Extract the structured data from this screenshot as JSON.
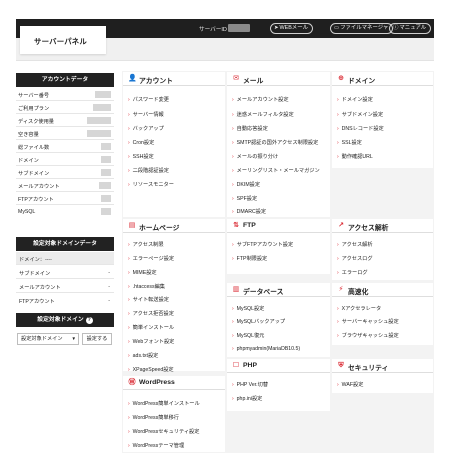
{
  "header": {
    "logo": "サーバーパネル",
    "server_id_label": "サーバーID",
    "buttons": [
      {
        "label": "WEBメール",
        "icon": "send-icon"
      },
      {
        "label": "ファイルマネージャ",
        "icon": "folder-icon"
      },
      {
        "label": "マニュアル",
        "icon": "info-icon"
      }
    ]
  },
  "account": {
    "title": "アカウントデータ",
    "rows": [
      {
        "label": "サーバー番号"
      },
      {
        "label": "ご利用プラン"
      },
      {
        "label": "ディスク使用量"
      },
      {
        "label": "空き容量"
      },
      {
        "label": "総ファイル数"
      },
      {
        "label": "ドメイン"
      },
      {
        "label": "サブドメイン"
      },
      {
        "label": "メールアカウント"
      },
      {
        "label": "FTPアカウント"
      },
      {
        "label": "MySQL"
      }
    ]
  },
  "domain_data": {
    "title": "設定対象ドメインデータ",
    "rows": [
      {
        "label": "ドメイン：----",
        "value": ""
      },
      {
        "label": "サブドメイン",
        "value": "-"
      },
      {
        "label": "メールアカウント",
        "value": "-"
      },
      {
        "label": "FTPアカウント",
        "value": "-"
      }
    ]
  },
  "target_domain": {
    "title": "設定対象ドメイン",
    "help_icon": "?",
    "select_value": "設定対象ドメイン",
    "button": "設定する"
  },
  "sections": {
    "account": {
      "title": "アカウント",
      "icon": "user-icon",
      "items": [
        "パスワード変更",
        "サーバー情報",
        "バックアップ",
        "Cron設定",
        "SSH設定",
        "二段階認証設定",
        "リソースモニター"
      ]
    },
    "mail": {
      "title": "メール",
      "icon": "mail-icon",
      "items": [
        "メールアカウント設定",
        "迷惑メールフィルタ設定",
        "自動応答設定",
        "SMTP認証の国外アクセス制限設定",
        "メールの振り分け",
        "メーリングリスト・メールマガジン",
        "DKIM設定",
        "SPF設定",
        "DMARC設定"
      ]
    },
    "domain": {
      "title": "ドメイン",
      "icon": "globe-icon",
      "items": [
        "ドメイン設定",
        "サブドメイン設定",
        "DNSレコード設定",
        "SSL設定",
        "動作確認URL"
      ]
    },
    "homepage": {
      "title": "ホームページ",
      "icon": "browser-icon",
      "items": [
        "アクセス制限",
        "エラーページ設定",
        "MIME設定",
        ".htaccess編集",
        "サイト転送設定",
        "アクセス拒否設定",
        "簡単インストール",
        "Webフォント設定",
        "ads.txt設定",
        "XPageSpeed設定"
      ]
    },
    "ftp": {
      "title": "FTP",
      "icon": "ftp-icon",
      "items": [
        "サブFTPアカウント設定",
        "FTP制限設定"
      ]
    },
    "access": {
      "title": "アクセス解析",
      "icon": "analytics-icon",
      "items": [
        "アクセス解析",
        "アクセスログ",
        "エラーログ"
      ]
    },
    "database": {
      "title": "データベース",
      "icon": "database-icon",
      "items": [
        "MySQL設定",
        "MySQLバックアップ",
        "MySQL復元",
        "phpmyadmin(MariaDB10.5)"
      ]
    },
    "speedup": {
      "title": "高速化",
      "icon": "speed-icon",
      "items": [
        "Xアクセラレータ",
        "サーバーキャッシュ設定",
        "ブラウザキャッシュ設定"
      ]
    },
    "php": {
      "title": "PHP",
      "icon": "php-icon",
      "items": [
        "PHP Ver.切替",
        "php.ini設定"
      ]
    },
    "security": {
      "title": "セキュリティ",
      "icon": "shield-icon",
      "items": [
        "WAF設定"
      ]
    },
    "wordpress": {
      "title": "WordPress",
      "icon": "wordpress-icon",
      "items": [
        "WordPress簡単インストール",
        "WordPress簡単移行",
        "WordPressセキュリティ設定",
        "WordPressテーマ管理"
      ]
    }
  },
  "colors": {
    "accent": "#d9232d",
    "header_bg": "#1f1f1f",
    "sidebar_head": "#222222"
  }
}
